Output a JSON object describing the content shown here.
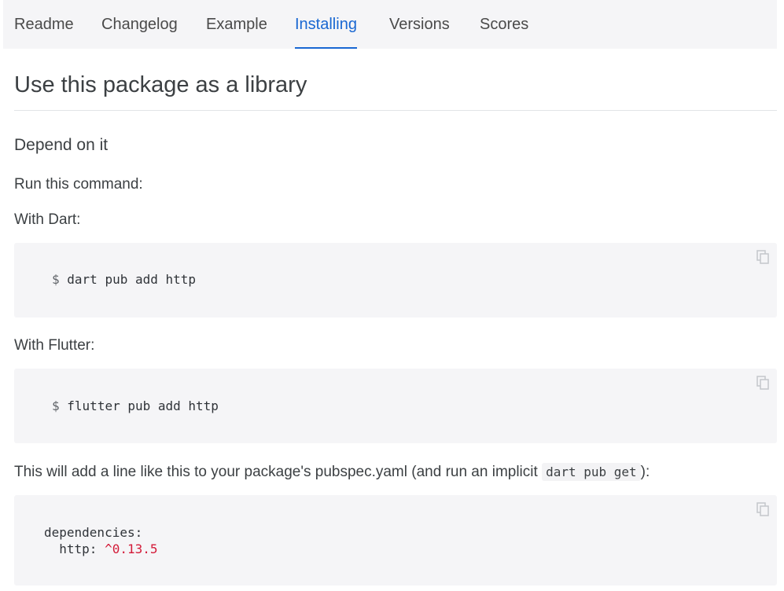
{
  "tabs": [
    {
      "label": "Readme",
      "active": false
    },
    {
      "label": "Changelog",
      "active": false
    },
    {
      "label": "Example",
      "active": false
    },
    {
      "label": "Installing",
      "active": true
    },
    {
      "label": "Versions",
      "active": false
    },
    {
      "label": "Scores",
      "active": false
    }
  ],
  "page": {
    "title": "Use this package as a library",
    "section_title": "Depend on it",
    "run_command": "Run this command:",
    "with_dart": "With Dart:",
    "with_flutter": "With Flutter:",
    "pubspec_note_before": "This will add a line like this to your package's pubspec.yaml (and run an implicit",
    "pubspec_note_code": "dart pub get",
    "pubspec_note_after": "):"
  },
  "code": {
    "dart_prompt": "$",
    "dart_command": "dart pub add http",
    "flutter_prompt": "$",
    "flutter_command": "flutter pub add http",
    "deps_line1": "dependencies:",
    "deps_key": "  http:",
    "deps_version": "^0.13.5"
  },
  "icons": {
    "copy": "copy-icon"
  },
  "colors": {
    "accent": "#1967d2",
    "code_bg": "#f5f5f7",
    "version_red": "#d31a38"
  }
}
